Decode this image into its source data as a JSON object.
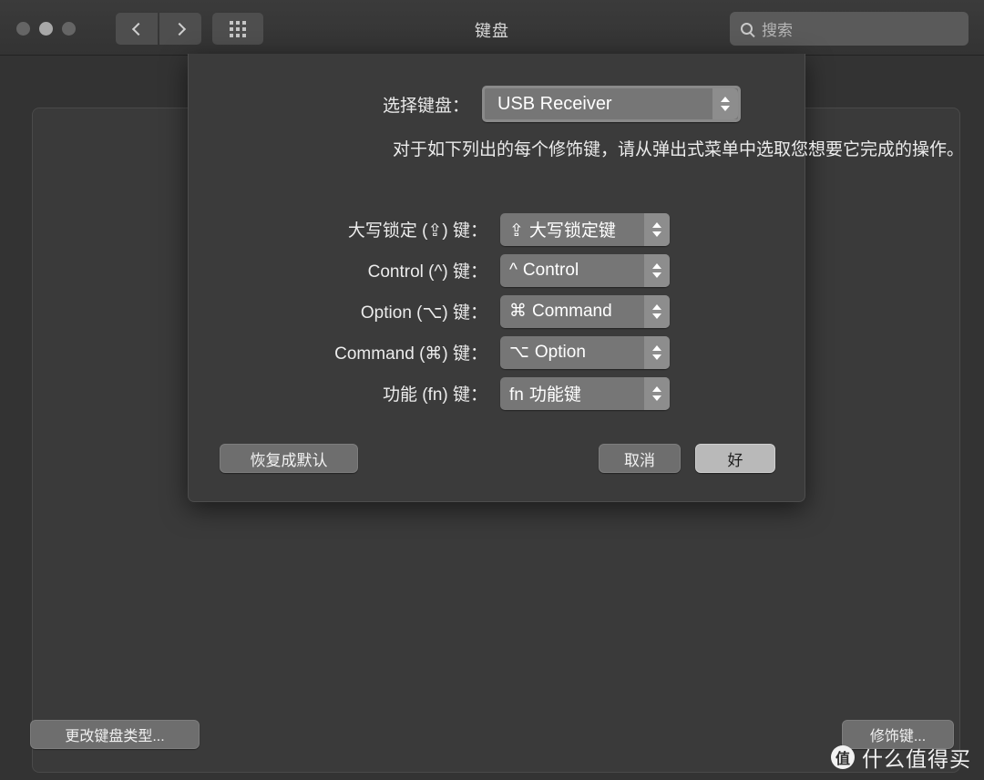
{
  "window": {
    "title": "键盘",
    "traffic_lights": [
      "close",
      "minimize",
      "zoom"
    ],
    "nav": {
      "back_icon": "chevron-left-icon",
      "forward_icon": "chevron-right-icon",
      "grid_icon": "show-all-grid-icon"
    },
    "search": {
      "placeholder": "搜索",
      "icon": "search-icon",
      "value": ""
    }
  },
  "main": {
    "change_keyboard_type_button": "更改键盘类型...",
    "modifier_keys_button": "修饰键..."
  },
  "sheet": {
    "select_keyboard_label": "选择键盘：",
    "selected_keyboard": "USB Receiver",
    "description": "对于如下列出的每个修饰键，请从弹出式菜单中选取您想要它完成的操作。",
    "modifiers": [
      {
        "label": "大写锁定 (⇪) 键：",
        "glyph": "⇪",
        "value": "大写锁定键"
      },
      {
        "label": "Control (^) 键：",
        "glyph": "^",
        "value": "Control"
      },
      {
        "label": "Option (⌥) 键：",
        "glyph": "⌘",
        "value": "Command"
      },
      {
        "label": "Command (⌘) 键：",
        "glyph": "⌥",
        "value": "Option"
      },
      {
        "label": "功能 (fn) 键：",
        "glyph": "fn",
        "value": "功能键"
      }
    ],
    "restore_defaults_button": "恢复成默认",
    "cancel_button": "取消",
    "ok_button": "好"
  },
  "watermark": {
    "logo": "值",
    "text": "什么值得买"
  },
  "colors": {
    "window_bg": "#333333",
    "panel_bg": "#3a3a3a",
    "sheet_bg": "#3b3b3b",
    "popup_bg": "#767676",
    "default_button_bg": "#b9b9b9",
    "text": "#ececec"
  }
}
